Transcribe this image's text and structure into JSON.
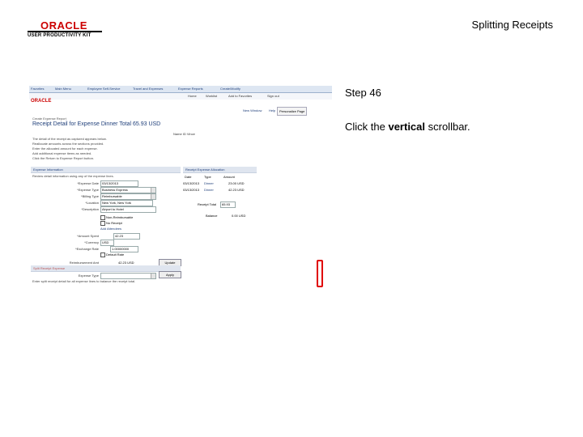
{
  "logo": {
    "brand": "ORACLE",
    "subtitle": "USER PRODUCTIVITY KIT"
  },
  "slide_title": "Splitting Receipts",
  "step": "Step 46",
  "instruction": {
    "prefix": "Click the ",
    "bold": "vertical",
    "suffix": " scrollbar."
  },
  "screenshot": {
    "nav": [
      "Favorites",
      "Main Menu",
      "Employee Self-Service",
      "Travel and Expenses",
      "Expense Reports",
      "Create/Modify"
    ],
    "nav2": [
      "Home",
      "Worklist",
      "Add to Favorites",
      "Sign out"
    ],
    "oracle": "ORACLE",
    "toolbar": [
      "New Window",
      "Help",
      "Personalize Page"
    ],
    "crumb": "Create Expense Report",
    "heading": "Receipt Detail for Expense Dinner  Total 65.93 USD",
    "employee": "Name  ID  Vince",
    "notes": [
      "The detail of the receipt as captured appears below.",
      "Reallocate amounts across the sections provided.",
      "Enter the allocated amount for each expense.",
      "Add additional expense items as needed.",
      "Click the Return to Expense Report button."
    ],
    "left_section": "Expense Information",
    "left_note": "Review detail information using any of the expense lines.",
    "fields": [
      {
        "label": "*Expense Date",
        "value": "03/13/2013"
      },
      {
        "label": "*Expense Type",
        "value": "Business Express"
      },
      {
        "label": "*Billing Type",
        "value": "Reimbursable"
      },
      {
        "label": "*Location",
        "value": "New York, New York"
      },
      {
        "label": "*Description",
        "value": "Airport to Hotel"
      }
    ],
    "checks": [
      "Non-Reimbursable",
      "No Receipt"
    ],
    "link1": "Add Attendees",
    "amount_label": "*Amount Spent",
    "amount_value": "42.23",
    "currency_label": "*Currency",
    "currency_value": "USD",
    "rate_label": "*Exchange Rate",
    "rate_value": "1.00000000",
    "default_rate": "Default Rate",
    "reimb_label": "Reimbursement Amt",
    "reimb_value": "42.23  USD",
    "split_section": "Split Receipt Expense",
    "expense_type_label": "Expense Type",
    "apply_button": "Apply",
    "update_button": "Update",
    "right_section": "Receipt Expense Allocation",
    "cols": [
      "Date",
      "Type",
      "Amount"
    ],
    "rows": [
      {
        "date": "03/13/2013",
        "type": "Dinner",
        "amount": "23.00 USD"
      },
      {
        "date": "03/13/2013",
        "type": "Dinner",
        "amount": "42.23 USD"
      }
    ],
    "receipt_total_label": "Receipt Total",
    "receipt_total_value": "65.93",
    "balance_label": "Balance",
    "balance_value": "0.00 USD",
    "footer": "Enter split receipt detail for all expense lines to balance the receipt total."
  }
}
